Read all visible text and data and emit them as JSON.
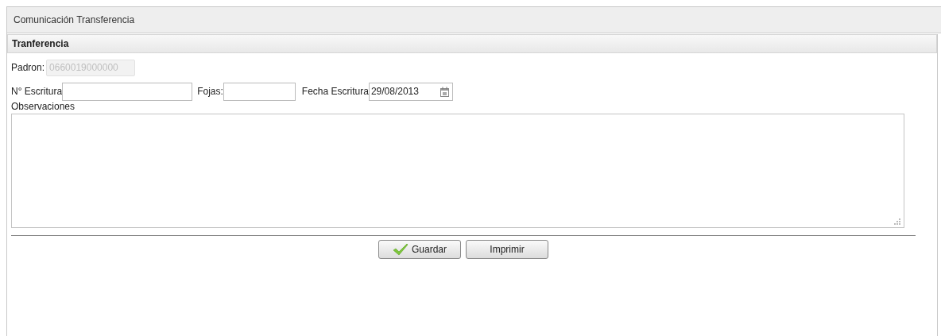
{
  "window": {
    "title": "Comunicación Transferencia"
  },
  "section": {
    "title": "Tranferencia"
  },
  "padron": {
    "label": "Padron:",
    "value": "0660019000000",
    "disabled": true
  },
  "escritura": {
    "label": "N° Escritura"
  },
  "fojas": {
    "label": "Fojas:"
  },
  "fecha": {
    "label": "Fecha Escritura",
    "value": "29/08/2013"
  },
  "observaciones": {
    "label": "Observaciones"
  },
  "buttons": [
    {
      "label": "Guardar",
      "kind": "save"
    },
    {
      "label": "Imprimir",
      "kind": "print"
    }
  ]
}
